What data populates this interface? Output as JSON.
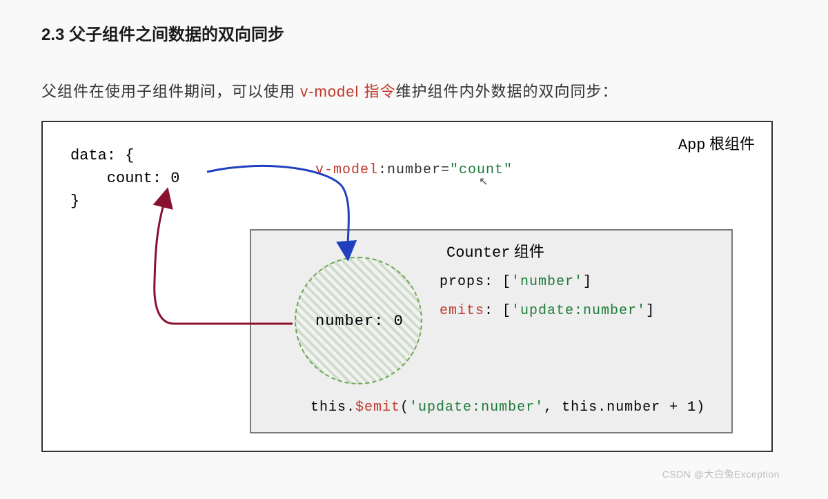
{
  "heading": "2.3 父子组件之间数据的双向同步",
  "intro": {
    "before": "父组件在使用子组件期间，可以使用 ",
    "highlight": "v-model 指令",
    "after": "维护组件内外数据的双向同步："
  },
  "app": {
    "label_code": "App",
    "label_cn": " 根组件",
    "data_block": "data: {\n    count: 0\n}"
  },
  "vmodel": {
    "red": "v-model",
    "mid": ":number=",
    "green": "\"count\""
  },
  "counter": {
    "label_code": "Counter",
    "label_cn": " 组件",
    "circle_text": "number: 0",
    "props_label": "props: [",
    "props_value": "'number'",
    "props_close": "]",
    "emits_label": "emits",
    "emits_mid": ": [",
    "emits_value": "'update:number'",
    "emits_close": "]",
    "emit_call_pre": "this.",
    "emit_call_red": "$emit",
    "emit_call_open": "(",
    "emit_call_green": "'update:number'",
    "emit_call_rest": ", this.number + 1)"
  },
  "watermark": "CSDN @大白兔Exception"
}
